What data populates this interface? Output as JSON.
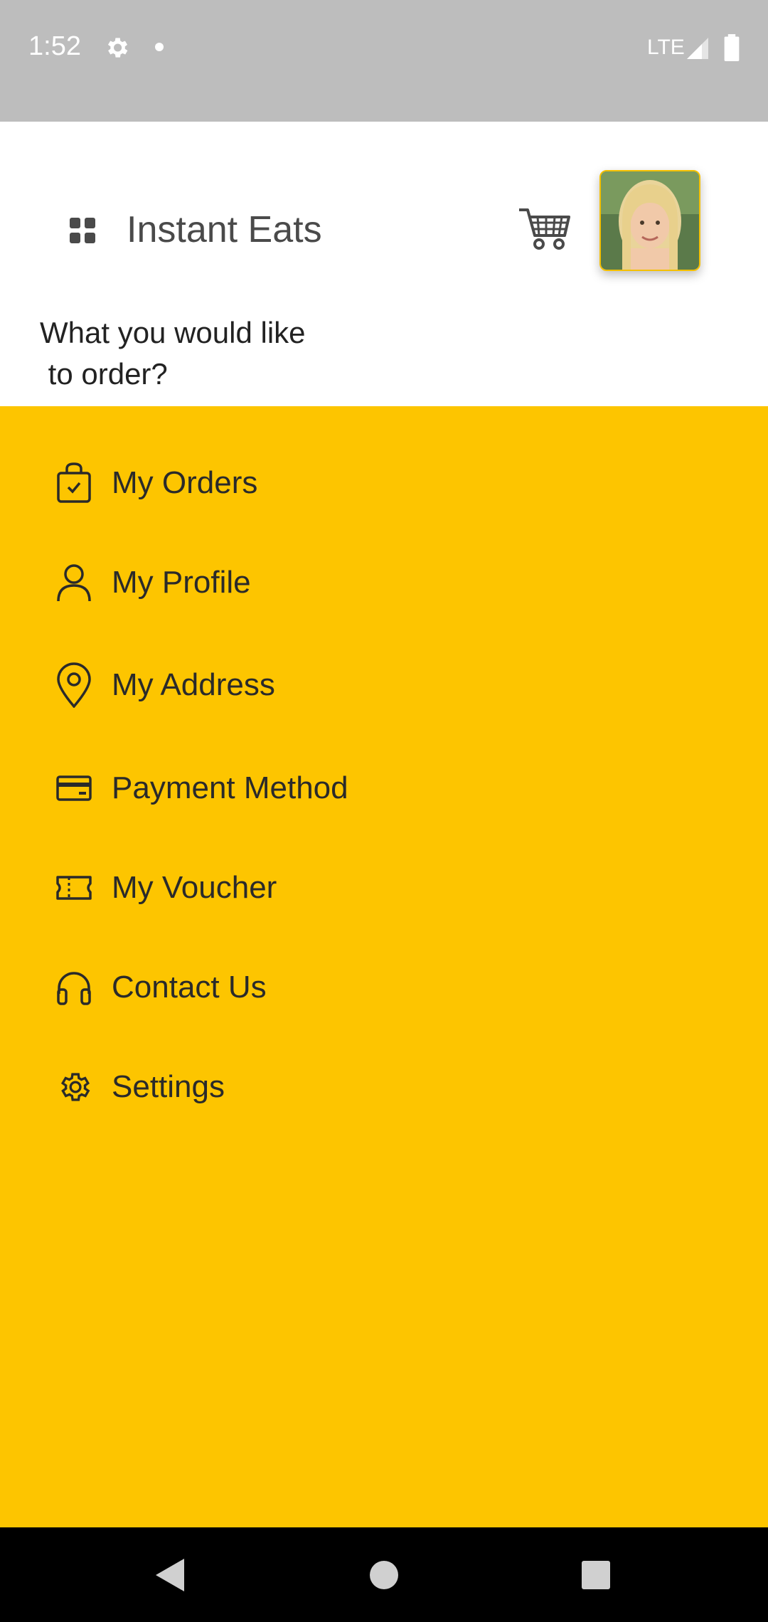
{
  "status_bar": {
    "time": "1:52",
    "network": "LTE",
    "icons": [
      "gear-icon",
      "notification-dot-icon",
      "signal-icon",
      "battery-icon"
    ]
  },
  "header": {
    "title": "Instant Eats",
    "subtitle": "What you would like\n to order?",
    "icons": [
      "menu-grid-icon",
      "cart-icon",
      "avatar"
    ]
  },
  "menu": {
    "items": [
      {
        "label": "My Orders",
        "icon": "shopping-bag-icon"
      },
      {
        "label": "My Profile",
        "icon": "user-icon"
      },
      {
        "label": "My Address",
        "icon": "location-pin-icon"
      },
      {
        "label": "Payment Method",
        "icon": "credit-card-icon"
      },
      {
        "label": "My Voucher",
        "icon": "ticket-icon"
      },
      {
        "label": "Contact Us",
        "icon": "headphones-icon"
      },
      {
        "label": "Settings",
        "icon": "gear-icon"
      }
    ]
  },
  "colors": {
    "drawer_bg": "#fdc500",
    "status_bar_bg": "#bdbdbd",
    "text": "#2a2a2a"
  },
  "nav_bar": {
    "buttons": [
      "back-button",
      "home-button",
      "recents-button"
    ]
  }
}
